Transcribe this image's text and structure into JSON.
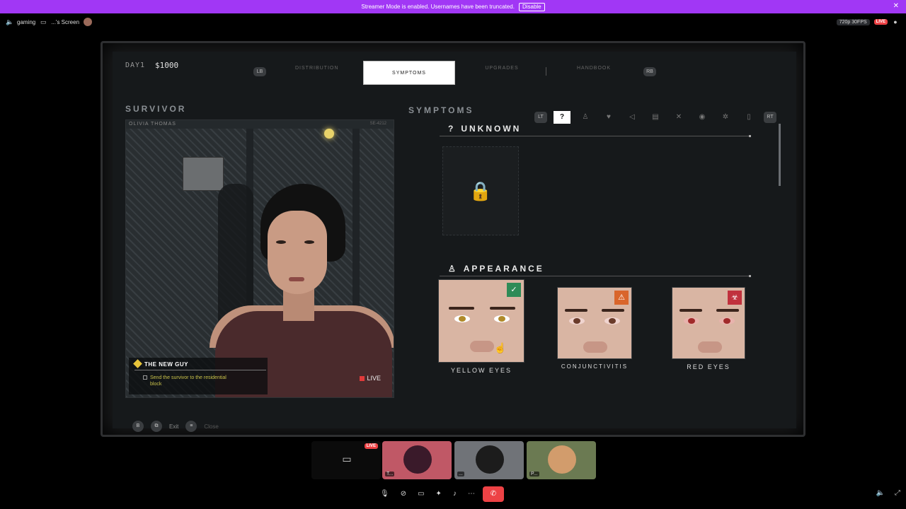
{
  "banner": {
    "text": "Streamer Mode is enabled. Usernames have been truncated.",
    "disable_label": "Disable",
    "close_icon": "close-icon"
  },
  "callbar": {
    "channel": "gaming",
    "screen_label": "...'s Screen",
    "quality": "720p 30FPS",
    "live": "LIVE"
  },
  "game": {
    "day": "DAY1",
    "money": "$1000",
    "shoulder_left": "LB",
    "shoulder_right": "RB",
    "tabs": [
      "DISTRIBUTION",
      "SYMPTOMS",
      "UPGRADES",
      "HANDBOOK"
    ],
    "active_tab": "SYMPTOMS",
    "survivor": {
      "section": "SURVIVOR",
      "name": "OLIVIA THOMAS",
      "code": "SE-4212",
      "quest_title": "THE NEW GUY",
      "quest_desc": "Send the survivor to the residential block",
      "live": "LIVE"
    },
    "symptoms": {
      "section": "SYMPTOMS",
      "trigger_left": "LT",
      "trigger_right": "RT",
      "tab_icons": [
        "question-icon",
        "person-icon",
        "heart-icon",
        "sound-icon",
        "stomach-icon",
        "bone-icon",
        "eye-icon",
        "virus-icon",
        "bottle-icon"
      ],
      "unknown": {
        "title": "UNKNOWN"
      },
      "appearance": {
        "title": "APPEARANCE",
        "cards": [
          {
            "label": "YELLOW EYES",
            "badge": "shield-check-icon",
            "badge_color": "#2e8b57",
            "iris": "#b08a2a"
          },
          {
            "label": "CONJUNCTIVITIS",
            "badge": "warning-icon",
            "badge_color": "#d9652b",
            "iris": "#6a3b2a"
          },
          {
            "label": "RED EYES",
            "badge": "biohazard-icon",
            "badge_color": "#c0313d",
            "iris": "#a02a2a"
          }
        ]
      }
    },
    "footer": {
      "back": "B",
      "exit": "Exit",
      "other": "Close"
    }
  },
  "participants": [
    {
      "name": "...",
      "bg": "#0b0b0b"
    },
    {
      "name": "T...",
      "bg": "#c05866"
    },
    {
      "name": "...",
      "bg": "#707378"
    },
    {
      "name": "P...",
      "bg": "#6b7a52"
    }
  ],
  "participant_live": "LIVE",
  "colors": {
    "accent": "#a137f5",
    "live": "#ed4245"
  }
}
